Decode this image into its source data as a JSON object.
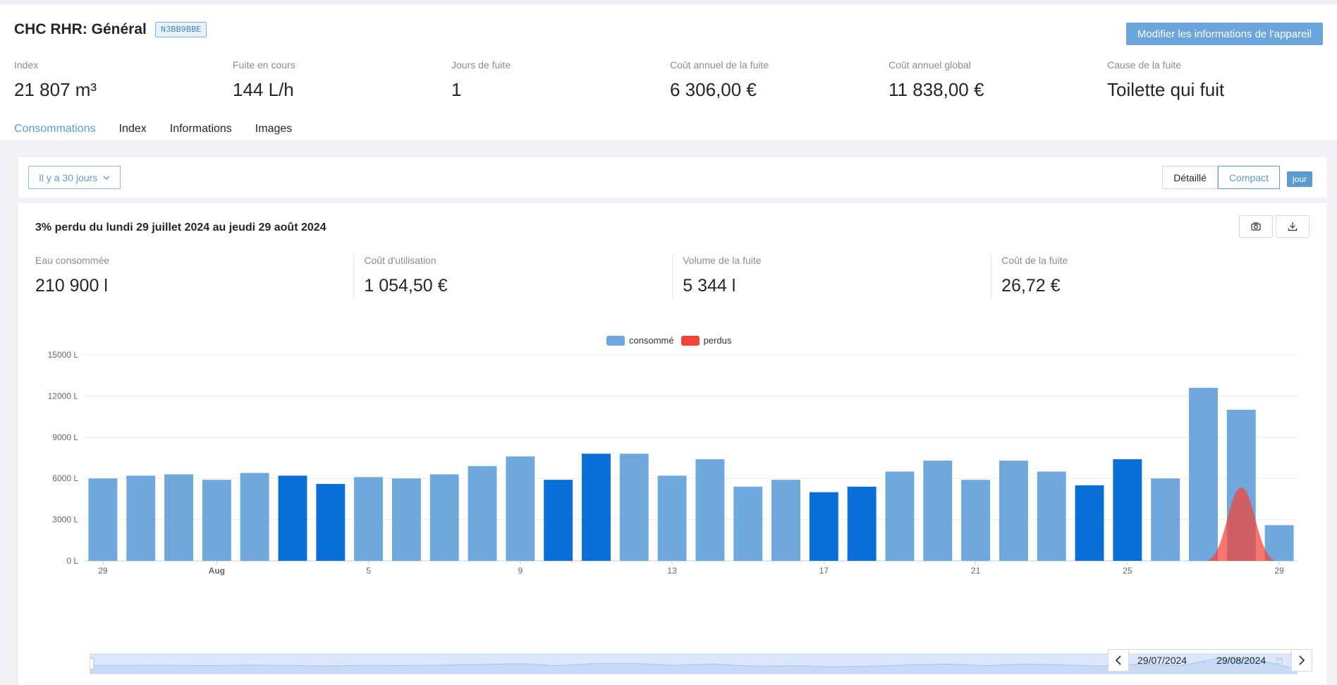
{
  "header": {
    "title": "CHC RHR: Général",
    "device_id": "N3BB9BBE",
    "edit_button": "Modifier les informations de l'appareil"
  },
  "stats": [
    {
      "label": "Index",
      "value": "21 807 m³"
    },
    {
      "label": "Fuite en cours",
      "value": "144 L/h"
    },
    {
      "label": "Jours de fuite",
      "value": "1"
    },
    {
      "label": "Coût annuel de la fuite",
      "value": "6 306,00 €"
    },
    {
      "label": "Coût annuel global",
      "value": "11 838,00 €"
    },
    {
      "label": "Cause de la fuite",
      "value": "Toilette qui fuit"
    }
  ],
  "tabs": [
    {
      "label": "Consommations",
      "active": true
    },
    {
      "label": "Index"
    },
    {
      "label": "Informations"
    },
    {
      "label": "Images"
    }
  ],
  "toolbar": {
    "range_select": "Il y a 30 jours",
    "view_detailed": "Détaillé",
    "view_compact": "Compact",
    "granularity": "jour"
  },
  "summary": {
    "title": "3% perdu du lundi 29 juillet 2024 au jeudi 29 août 2024",
    "metrics": [
      {
        "label": "Eau consommée",
        "value": "210 900 l"
      },
      {
        "label": "Coût d'utilisation",
        "value": "1 054,50 €"
      },
      {
        "label": "Volume de la fuite",
        "value": "5 344 l"
      },
      {
        "label": "Coût de la fuite",
        "value": "26,72 €"
      }
    ]
  },
  "chart_data": {
    "type": "bar",
    "legend": [
      {
        "name": "consommé",
        "color": "#6fa8dc"
      },
      {
        "name": "perdus",
        "color": "#f44336"
      }
    ],
    "legend_position": "top-center",
    "y_ticks": [
      "0 L",
      "3000 L",
      "6000 L",
      "9000 L",
      "12000 L",
      "15000 L"
    ],
    "ylim": [
      0,
      15000
    ],
    "x_tick_labels": [
      "29",
      "Aug",
      "5",
      "9",
      "13",
      "17",
      "21",
      "25",
      "29"
    ],
    "x_tick_indices": [
      0,
      3,
      7,
      11,
      15,
      19,
      23,
      27,
      31
    ],
    "categories": [
      "29/07",
      "30/07",
      "31/07",
      "01/08",
      "02/08",
      "03/08",
      "04/08",
      "05/08",
      "06/08",
      "07/08",
      "08/08",
      "09/08",
      "10/08",
      "11/08",
      "12/08",
      "13/08",
      "14/08",
      "15/08",
      "16/08",
      "17/08",
      "18/08",
      "19/08",
      "20/08",
      "21/08",
      "22/08",
      "23/08",
      "24/08",
      "25/08",
      "26/08",
      "27/08",
      "28/08",
      "29/08"
    ],
    "series": [
      {
        "name": "consommé",
        "values": [
          6000,
          6200,
          6300,
          5900,
          6400,
          6200,
          5600,
          6100,
          6000,
          6300,
          6900,
          7600,
          5900,
          7800,
          7800,
          6200,
          7400,
          5400,
          5900,
          5000,
          5400,
          6500,
          7300,
          5900,
          7300,
          6500,
          5500,
          7400,
          6000,
          12600,
          11000,
          2600
        ],
        "weekend": [
          false,
          false,
          false,
          false,
          false,
          true,
          true,
          false,
          false,
          false,
          false,
          false,
          true,
          true,
          false,
          false,
          false,
          false,
          false,
          true,
          true,
          false,
          false,
          false,
          false,
          false,
          true,
          true,
          false,
          false,
          false,
          false
        ]
      },
      {
        "name": "perdus",
        "peak_index": 30,
        "peak_value": 5344
      }
    ],
    "colors": {
      "weekday": "#6fa8dc",
      "weekend": "#0b6fd9",
      "leak": "#f44336",
      "grid": "#ececec"
    }
  },
  "date_range": {
    "start": "29/07/2024",
    "end": "29/08/2024"
  }
}
